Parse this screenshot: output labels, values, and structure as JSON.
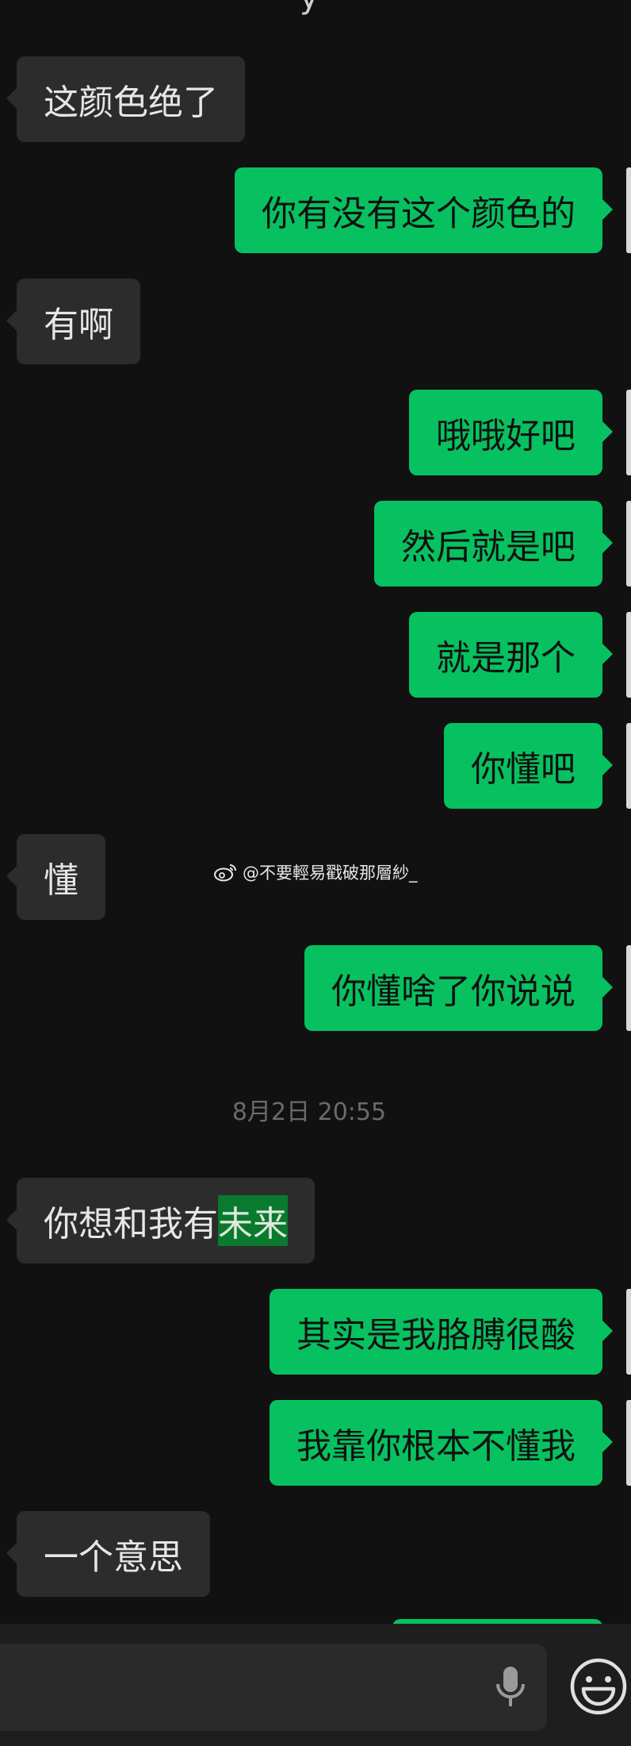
{
  "top_fragment": "y",
  "messages": [
    {
      "side": "in",
      "text": "这颜色绝了"
    },
    {
      "side": "out",
      "text": "你有没有这个颜色的"
    },
    {
      "side": "in",
      "text": "有啊"
    },
    {
      "side": "out",
      "text": "哦哦好吧"
    },
    {
      "side": "out",
      "text": "然后就是吧"
    },
    {
      "side": "out",
      "text": "就是那个"
    },
    {
      "side": "out",
      "text": "你懂吧"
    },
    {
      "side": "in",
      "text": "懂"
    },
    {
      "side": "out",
      "text": "你懂啥了你说说"
    },
    {
      "side": "in",
      "text_before": "你想和我有",
      "text_highlight": "未来"
    },
    {
      "side": "out",
      "text": "其实是我胳膊很酸"
    },
    {
      "side": "out",
      "text": "我靠你根本不懂我"
    },
    {
      "side": "in",
      "text": "一个意思"
    }
  ],
  "timestamp": "8月2日 20:55",
  "watermark": "@不要輕易戳破那層紗_",
  "input": {
    "value": ""
  },
  "icons": {
    "mic": "microphone-icon",
    "emoji": "emoji-icon",
    "weibo": "weibo-logo-icon"
  },
  "colors": {
    "background": "#111111",
    "incoming": "#2c2c2c",
    "outgoing": "#07c160",
    "highlight": "#0a7a2e",
    "timestamp": "#6b6b6b"
  }
}
